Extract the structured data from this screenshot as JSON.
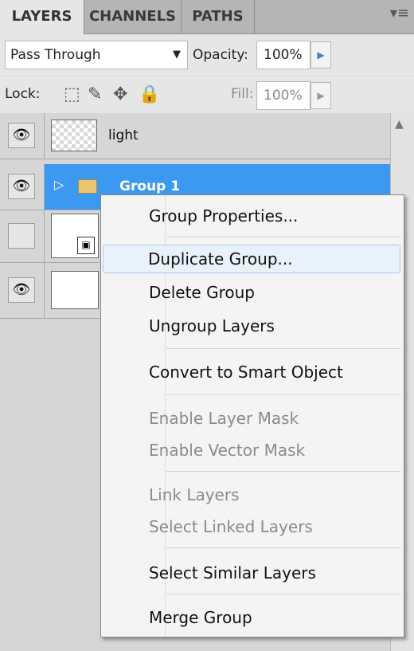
{
  "tabs": {
    "layers": "LAYERS",
    "channels": "CHANNELS",
    "paths": "PATHS",
    "menu_icon": "▾≡"
  },
  "blend": {
    "mode": "Pass Through",
    "opacity_label": "Opacity:",
    "opacity_value": "100%"
  },
  "lock": {
    "label": "Lock:",
    "fill_label": "Fill:",
    "fill_value": "100%"
  },
  "layers": [
    {
      "name": "light",
      "visible": true
    },
    {
      "name": "Group 1",
      "visible": true,
      "selected": true
    }
  ],
  "context_menu": {
    "items": [
      "Group Properties...",
      "Duplicate Group...",
      "Delete Group",
      "Ungroup Layers",
      "Convert to Smart Object",
      "Enable Layer Mask",
      "Enable Vector Mask",
      "Link Layers",
      "Select Linked Layers",
      "Select Similar Layers",
      "Merge Group"
    ],
    "highlighted": "Duplicate Group...",
    "disabled": [
      "Enable Layer Mask",
      "Enable Vector Mask",
      "Link Layers",
      "Select Linked Layers"
    ]
  },
  "colors": {
    "selection": "#3c98f0",
    "panel": "#d6d6d6",
    "menu_bg": "#f4f4f4"
  }
}
